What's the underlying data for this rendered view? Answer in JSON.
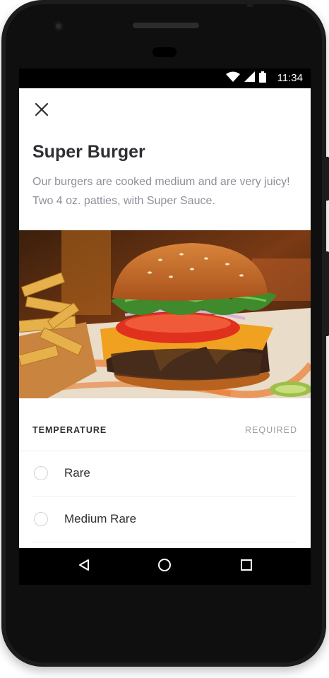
{
  "status_bar": {
    "time": "11:34",
    "icons": [
      "wifi-icon",
      "signal-icon",
      "battery-icon"
    ]
  },
  "header": {
    "close_icon": "close-icon"
  },
  "item": {
    "title": "Super Burger",
    "description": "Our burgers are cooked medium and are very juicy! Two 4 oz. patties, with Super Sauce."
  },
  "temperature": {
    "title": "TEMPERATURE",
    "required_label": "REQUIRED",
    "options": [
      {
        "label": "Rare",
        "selected": false
      },
      {
        "label": "Medium Rare",
        "selected": false
      }
    ]
  },
  "nav_bar": {
    "icons": [
      "back-icon",
      "home-icon",
      "recents-icon"
    ]
  },
  "colors": {
    "text_primary": "#2e2f33",
    "text_secondary": "#8e9099",
    "divider": "#ececec",
    "phone_body": "#1c1c1e"
  }
}
